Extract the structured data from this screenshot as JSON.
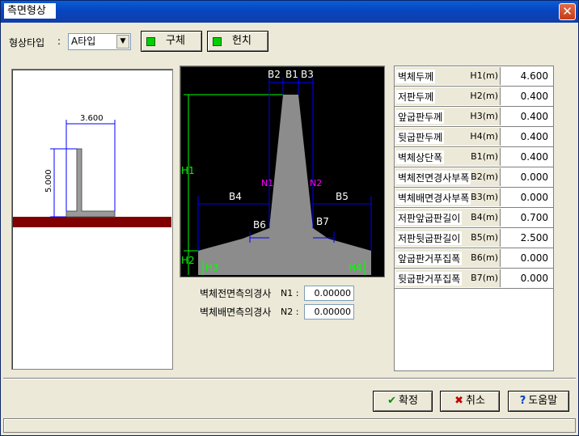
{
  "window": {
    "title": "측면형상"
  },
  "shape_type": {
    "label": "형상타입",
    "colon": ":",
    "selected": "A타입"
  },
  "tabs": [
    {
      "label": "구체"
    },
    {
      "label": "헌치"
    }
  ],
  "preview": {
    "width_label": "3.600",
    "height_label": "5.000"
  },
  "diagram": {
    "labels": {
      "b1": "B1",
      "b2": "B2",
      "b3": "B3",
      "b4": "B4",
      "b5": "B5",
      "b6": "B6",
      "b7": "B7",
      "h1": "H1",
      "h2": "H2",
      "h3": "H3",
      "h4": "H4",
      "n1": "N1",
      "n2": "N2"
    }
  },
  "params": [
    {
      "name": "벽체두께",
      "unit": "H1(m)",
      "value": "4.600"
    },
    {
      "name": "저판두께",
      "unit": "H2(m)",
      "value": "0.400"
    },
    {
      "name": "앞굽판두께",
      "unit": "H3(m)",
      "value": "0.400"
    },
    {
      "name": "뒷굽판두께",
      "unit": "H4(m)",
      "value": "0.400"
    },
    {
      "name": "벽체상단폭",
      "unit": "B1(m)",
      "value": "0.400"
    },
    {
      "name": "벽체전면경사부폭",
      "unit": "B2(m)",
      "value": "0.000"
    },
    {
      "name": "벽체배면경사부폭",
      "unit": "B3(m)",
      "value": "0.000"
    },
    {
      "name": "저판앞굽판길이",
      "unit": "B4(m)",
      "value": "0.700"
    },
    {
      "name": "저판뒷굽판길이",
      "unit": "B5(m)",
      "value": "2.500"
    },
    {
      "name": "앞굽판거푸집폭",
      "unit": "B6(m)",
      "value": "0.000"
    },
    {
      "name": "뒷굽판거푸집폭",
      "unit": "B7(m)",
      "value": "0.000"
    }
  ],
  "slopes": {
    "n1_label": "벽체전면측의경사",
    "n1_key": "N1 :",
    "n1_value": "0.00000",
    "n2_label": "벽체배면측의경사",
    "n2_key": "N2 :",
    "n2_value": "0.00000"
  },
  "buttons": {
    "ok": "확정",
    "cancel": "취소",
    "help": "도움말"
  },
  "colors": {
    "titlebar": "#0846c2",
    "diagram_bg": "#000000",
    "diagram_shape": "#8c8c8c",
    "dim_line_blue": "#0000ff",
    "dim_green": "#00ff00",
    "slope_magenta": "#ff00ff",
    "ground": "#800000"
  }
}
